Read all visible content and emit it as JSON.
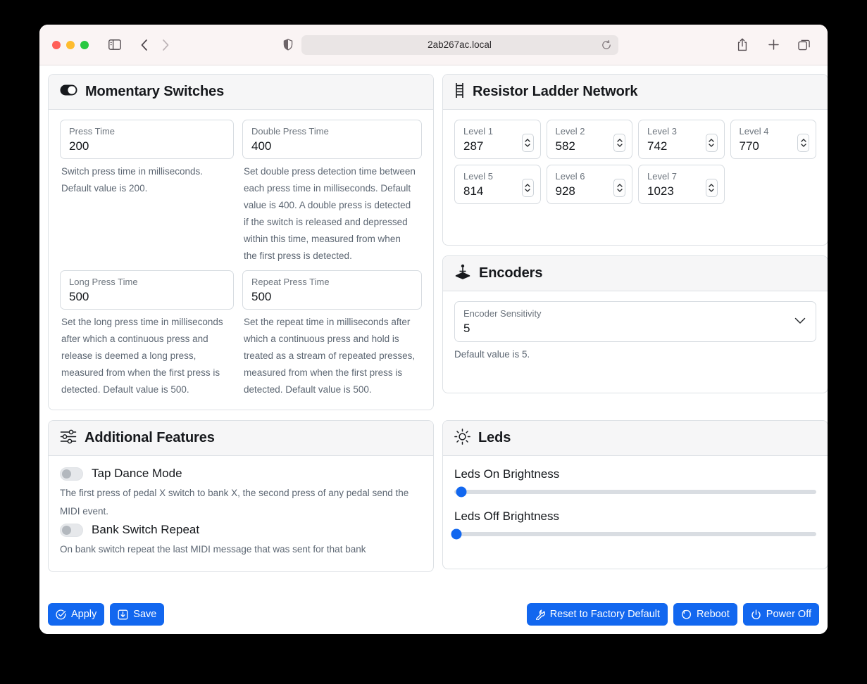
{
  "browser": {
    "url": "2ab267ac.local",
    "icons": {
      "sidebar": "sidebar-toggle-icon",
      "back": "chevron-left-icon",
      "forward": "chevron-right-icon",
      "shield": "shield-icon",
      "reload": "reload-icon",
      "share": "share-icon",
      "new_tab": "plus-icon",
      "tabs": "tabs-overview-icon"
    }
  },
  "momentary": {
    "title": "Momentary Switches",
    "icon": "toggle-on-icon",
    "fields": [
      {
        "label": "Press Time",
        "value": "200",
        "help": "Switch press time in milliseconds. Default value is 200."
      },
      {
        "label": "Double Press Time",
        "value": "400",
        "help": "Set double press detection time between each press time in milliseconds. Default value is 400. A double press is detected if the switch is released and depressed within this time, measured from when the first press is detected."
      },
      {
        "label": "Long Press Time",
        "value": "500",
        "help": "Set the long press time in milliseconds after which a continuous press and release is deemed a long press, measured from when the first press is detected. Default value is 500."
      },
      {
        "label": "Repeat Press Time",
        "value": "500",
        "help": "Set the repeat time in milliseconds after which a continuous press and hold is treated as a stream of repeated presses, measured from when the first press is detected. Default value is 500."
      }
    ]
  },
  "resistor_ladder": {
    "title": "Resistor Ladder Network",
    "icon": "ladder-icon",
    "levels": [
      {
        "label": "Level 1",
        "value": "287"
      },
      {
        "label": "Level 2",
        "value": "582"
      },
      {
        "label": "Level 3",
        "value": "742"
      },
      {
        "label": "Level 4",
        "value": "770"
      },
      {
        "label": "Level 5",
        "value": "814"
      },
      {
        "label": "Level 6",
        "value": "928"
      },
      {
        "label": "Level 7",
        "value": "1023"
      }
    ]
  },
  "encoders": {
    "title": "Encoders",
    "icon": "joystick-icon",
    "sensitivity": {
      "label": "Encoder Sensitivity",
      "value": "5",
      "help": "Default value is 5."
    }
  },
  "additional_features": {
    "title": "Additional Features",
    "icon": "sliders-icon",
    "toggles": [
      {
        "label": "Tap Dance Mode",
        "state": "off",
        "help": "The first press of pedal X switch to bank X, the second press of any pedal send the MIDI event."
      },
      {
        "label": "Bank Switch Repeat",
        "state": "off",
        "help": "On bank switch repeat the last MIDI message that was sent for that bank"
      }
    ]
  },
  "leds": {
    "title": "Leds",
    "icon": "sun-icon",
    "sliders": [
      {
        "label": "Leds On Brightness",
        "percent": 2
      },
      {
        "label": "Leds Off Brightness",
        "percent": 0
      }
    ]
  },
  "footer": {
    "accent_color": "#1267ef",
    "left_buttons": [
      {
        "label": "Apply",
        "icon": "check-circle-icon"
      },
      {
        "label": "Save",
        "icon": "save-icon"
      }
    ],
    "right_buttons": [
      {
        "label": "Reset to Factory Default",
        "icon": "wrench-icon"
      },
      {
        "label": "Reboot",
        "icon": "reboot-icon"
      },
      {
        "label": "Power Off",
        "icon": "power-icon"
      }
    ]
  }
}
